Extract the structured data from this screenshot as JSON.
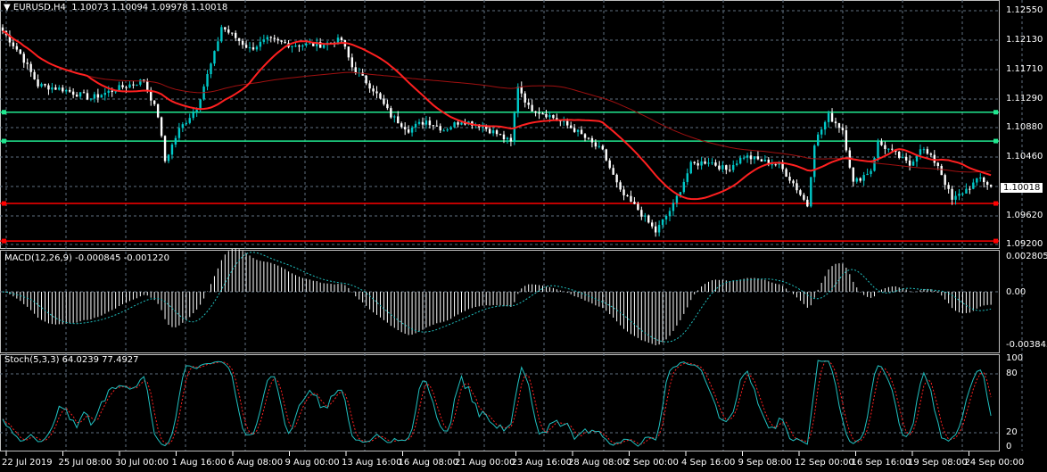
{
  "header": {
    "symbol": "EURUSD,H4",
    "open": "1.10073",
    "high": "1.10094",
    "low": "1.09978",
    "close": "1.10018"
  },
  "macd": {
    "label": "MACD(12,26,9) -0.000845 -0.001220",
    "axis": [
      "0.002805",
      "0.00",
      "-0.003845"
    ]
  },
  "stoch": {
    "label": "Stoch(5,3,3) 64.0239 77.4927",
    "axis": [
      "100",
      "80",
      "20",
      "0"
    ]
  },
  "price_axis": [
    "1.12550",
    "1.12130",
    "1.11710",
    "1.11290",
    "1.10880",
    "1.10460",
    "1.10040",
    "1.09620",
    "1.09200"
  ],
  "current_price": "1.10018",
  "time_axis": [
    "22 Jul 2019",
    "25 Jul 08:00",
    "30 Jul 00:00",
    "1 Aug 16:00",
    "6 Aug 08:00",
    "9 Aug 00:00",
    "13 Aug 16:00",
    "16 Aug 08:00",
    "21 Aug 00:00",
    "23 Aug 16:00",
    "28 Aug 08:00",
    "2 Sep 00:00",
    "4 Sep 16:00",
    "9 Sep 08:00",
    "12 Sep 00:00",
    "16 Sep 16:00",
    "19 Sep 08:00",
    "24 Sep 00:00"
  ],
  "colors": {
    "bull": "#00c8c8",
    "bear": "#ffffff",
    "ma_fast": "#ff2020",
    "ma_slow": "#a01010",
    "support": "#ff0000",
    "resistance": "#20e890",
    "signal": "#20c0c0"
  },
  "chart_data": {
    "type": "candlestick",
    "price_range": [
      1.092,
      1.1255
    ],
    "anchors": [
      [
        0,
        1.1226
      ],
      [
        5,
        1.1193
      ],
      [
        10,
        1.1148
      ],
      [
        17,
        1.1142
      ],
      [
        25,
        1.1129
      ],
      [
        32,
        1.1142
      ],
      [
        40,
        1.1155
      ],
      [
        44,
        1.1104
      ],
      [
        46,
        1.1039
      ],
      [
        50,
        1.1084
      ],
      [
        55,
        1.1116
      ],
      [
        60,
        1.1193
      ],
      [
        62,
        1.1232
      ],
      [
        70,
        1.12
      ],
      [
        75,
        1.1213
      ],
      [
        82,
        1.1206
      ],
      [
        90,
        1.1206
      ],
      [
        96,
        1.1213
      ],
      [
        99,
        1.1174
      ],
      [
        105,
        1.1142
      ],
      [
        110,
        1.1104
      ],
      [
        115,
        1.1084
      ],
      [
        120,
        1.1097
      ],
      [
        125,
        1.1084
      ],
      [
        130,
        1.1097
      ],
      [
        135,
        1.1091
      ],
      [
        140,
        1.1078
      ],
      [
        144,
        1.1065
      ],
      [
        146,
        1.1148
      ],
      [
        149,
        1.1116
      ],
      [
        155,
        1.1104
      ],
      [
        162,
        1.1084
      ],
      [
        170,
        1.1052
      ],
      [
        175,
        1.0994
      ],
      [
        180,
        1.0969
      ],
      [
        185,
        1.0937
      ],
      [
        190,
        1.0975
      ],
      [
        195,
        1.1033
      ],
      [
        200,
        1.1039
      ],
      [
        205,
        1.1026
      ],
      [
        210,
        1.1046
      ],
      [
        215,
        1.1039
      ],
      [
        220,
        1.1033
      ],
      [
        224,
        1.1007
      ],
      [
        228,
        1.0975
      ],
      [
        230,
        1.1065
      ],
      [
        234,
        1.1104
      ],
      [
        238,
        1.1084
      ],
      [
        241,
        1.1007
      ],
      [
        246,
        1.1026
      ],
      [
        248,
        1.1065
      ],
      [
        252,
        1.1052
      ],
      [
        257,
        1.1033
      ],
      [
        260,
        1.1059
      ],
      [
        265,
        1.1033
      ],
      [
        269,
        1.0982
      ],
      [
        272,
        1.0994
      ],
      [
        277,
        1.1014
      ],
      [
        280,
        1.1002
      ]
    ],
    "horizontal_lines": [
      {
        "price": 1.1109,
        "kind": "resistance"
      },
      {
        "price": 1.10675,
        "kind": "resistance"
      },
      {
        "price": 1.09777,
        "kind": "support"
      },
      {
        "price": 1.09237,
        "kind": "support"
      }
    ],
    "indicators": [
      "MA fast",
      "MA slow",
      "MACD(12,26,9)",
      "Stoch(5,3,3)"
    ]
  }
}
